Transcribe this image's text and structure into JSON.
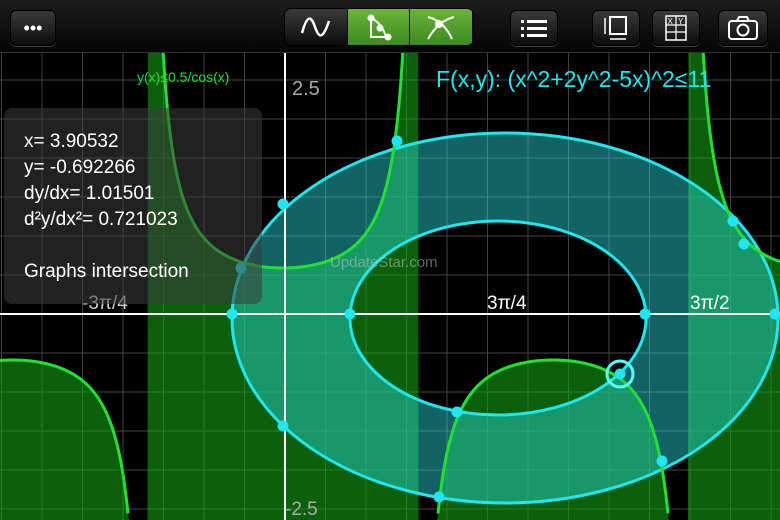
{
  "toolbar": {
    "more_label": "•••",
    "modes": [
      "function-graph",
      "trace",
      "intersection"
    ],
    "active_mode": "intersection"
  },
  "labels": {
    "y_top": "2.5",
    "y_bottom": "-2.5",
    "x_neg": "-3π/4",
    "x_pos1": "3π/4",
    "x_pos2": "3π/2",
    "watermark": "UpdateStar.com"
  },
  "equations": {
    "green": "y(x)≤0.5/cos(x)",
    "cyan": "F(x,y): (x^2+2y^2-5x)^2≤11"
  },
  "info": {
    "x": "x=  3.90532",
    "y": "y= -0.692266",
    "dydx": "dy/dx=  1.01501",
    "d2": "d²y/dx²=  0.721023",
    "mode": "Graphs intersection"
  },
  "colors": {
    "green": "#22e030",
    "cyan": "#1fe6f0",
    "active": "#4c9c2a"
  }
}
